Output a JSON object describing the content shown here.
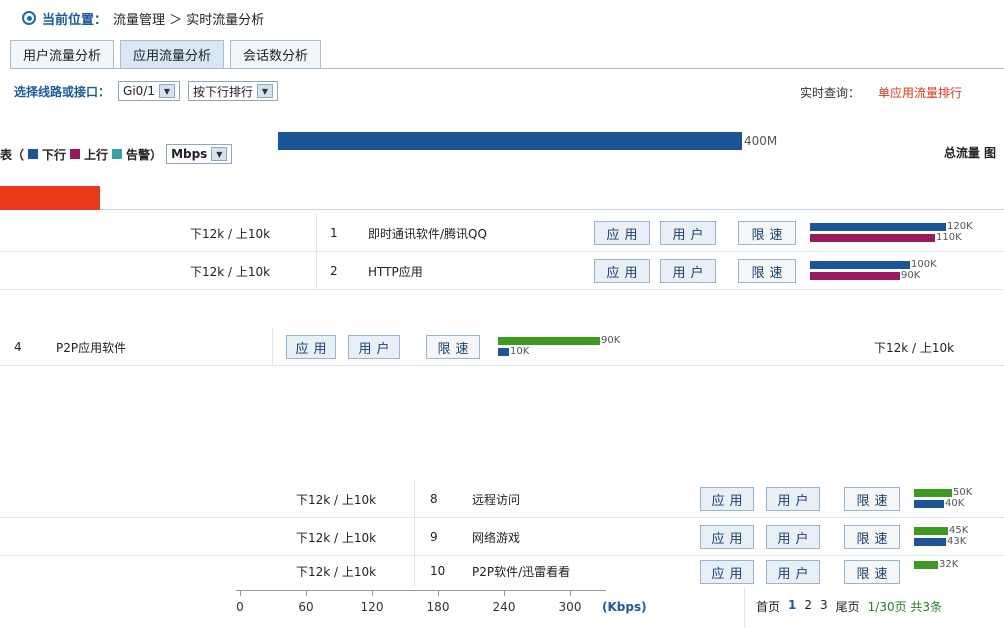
{
  "breadcrumb": {
    "label": "当前位置：",
    "path": "流量管理 ＞ 实时流量分析"
  },
  "tabs": [
    {
      "label": "用户流量分析",
      "active": false
    },
    {
      "label": "应用流量分析",
      "active": true
    },
    {
      "label": "会话数分析",
      "active": false
    }
  ],
  "toolbar": {
    "interface_label": "选择线路或接口：",
    "interface_value": "Gi0/1",
    "sort_value": "按下行排行",
    "note_prefix": "实时查询：",
    "note_link": "单应用流量排行"
  },
  "legend": {
    "prefix": "表（",
    "down": "下行",
    "up": "上行",
    "alarm": "告警）",
    "unit_value": "Mbps",
    "scale_label": "400M",
    "total_label": "总流量 图"
  },
  "colors": {
    "down": "#1b5597",
    "up": "#9b1a5d",
    "alarm": "#3aa0a0",
    "green": "#3c9a1e",
    "accent": "#1d5aa0"
  },
  "action_labels": {
    "app": "应用",
    "user": "用户",
    "speed": "限速"
  },
  "rows": [
    {
      "limit": "下12k / 上10k",
      "rank": "1",
      "name": "即时通讯软件/腾讯QQ",
      "bars": [
        {
          "color": "down",
          "ratio": 1.0,
          "label": "120K"
        },
        {
          "color": "up",
          "ratio": 0.917,
          "label": "110K"
        }
      ]
    },
    {
      "limit": "下12k / 上10k",
      "rank": "2",
      "name": "HTTP应用",
      "bars": [
        {
          "color": "down",
          "ratio": 0.833,
          "label": "100K"
        },
        {
          "color": "up",
          "ratio": 0.75,
          "label": "90K"
        }
      ]
    },
    {
      "limit": "下12k / 上10k",
      "rank": "4",
      "name": "P2P应用软件",
      "bars": [
        {
          "color": "green",
          "ratio": 0.75,
          "label": "90K"
        },
        {
          "color": "down",
          "ratio": 0.083,
          "label": "10K"
        }
      ]
    },
    {
      "limit": "下12k / 上10k",
      "rank": "8",
      "name": "远程访问",
      "bars": [
        {
          "color": "green",
          "ratio": 0.417,
          "label": "50K"
        },
        {
          "color": "down",
          "ratio": 0.333,
          "label": "40K"
        }
      ]
    },
    {
      "limit": "下12k / 上10k",
      "rank": "9",
      "name": "网络游戏",
      "bars": [
        {
          "color": "green",
          "ratio": 0.375,
          "label": "45K"
        },
        {
          "color": "down",
          "ratio": 0.358,
          "label": "43K"
        }
      ]
    },
    {
      "limit": "下12k / 上10k",
      "rank": "10",
      "name": "P2P软件/迅雷看看",
      "bars": [
        {
          "color": "green",
          "ratio": 0.267,
          "label": "32K"
        }
      ]
    }
  ],
  "axis": {
    "ticks": [
      "0",
      "60",
      "120",
      "180",
      "240",
      "300"
    ],
    "unit": "(Kbps)"
  },
  "pager": {
    "first": "首页",
    "pages": [
      "1",
      "2",
      "3"
    ],
    "current": "1",
    "last": "尾页",
    "info": "1/30页 共3条"
  }
}
